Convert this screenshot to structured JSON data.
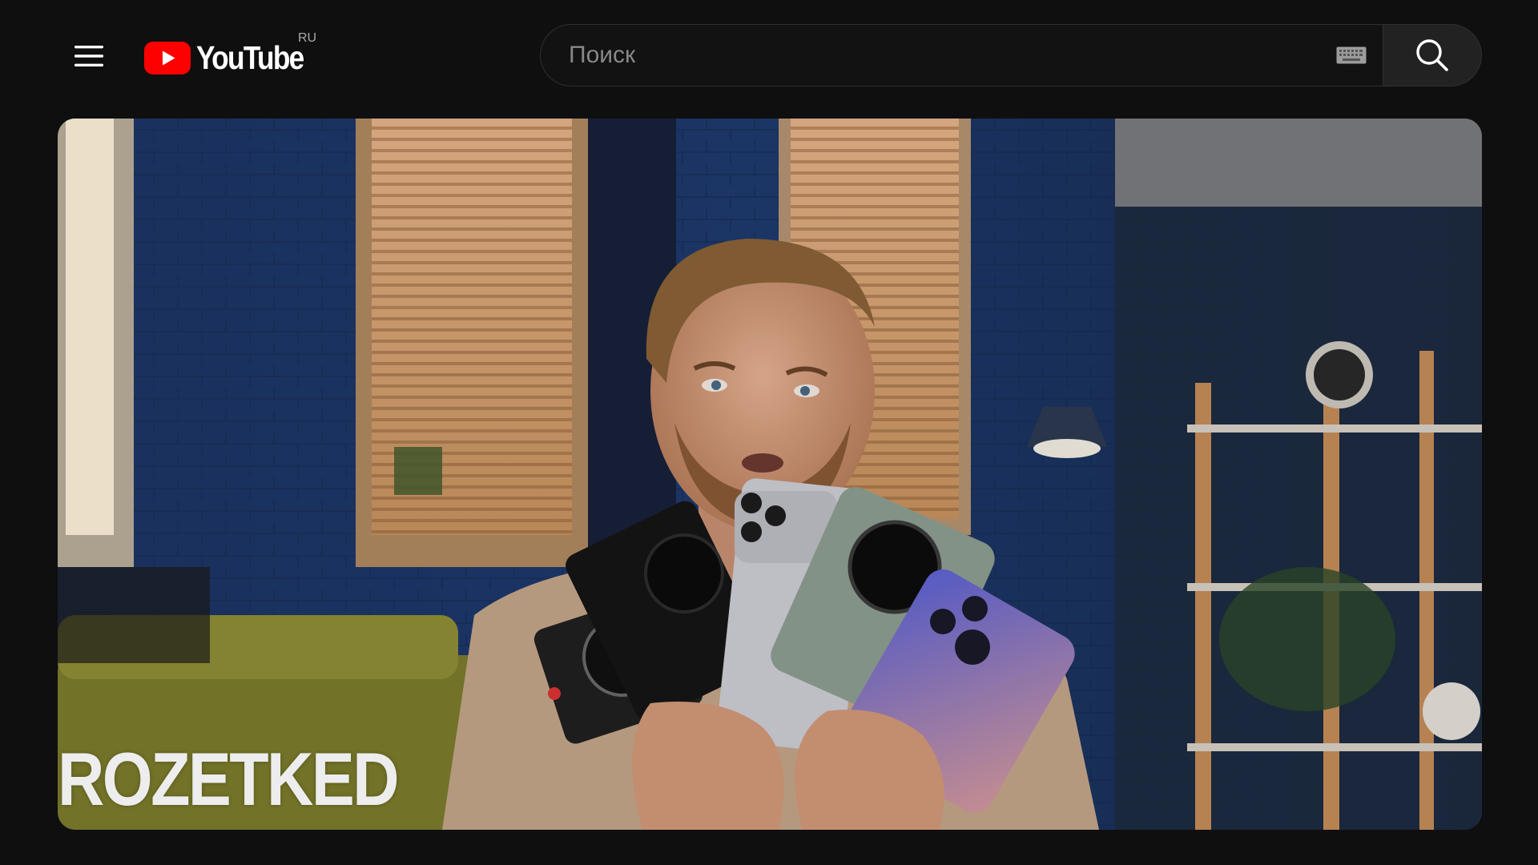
{
  "header": {
    "logo_text": "YouTube",
    "country_code": "RU"
  },
  "search": {
    "placeholder": "Поиск"
  },
  "player": {
    "channel_watermark": "ROZETKED"
  },
  "colors": {
    "background": "#0f0f0f",
    "brand_red": "#ff0000",
    "search_border": "#303030",
    "search_button_bg": "#222222"
  },
  "icons": {
    "menu": "hamburger-menu-icon",
    "logo": "youtube-play-icon",
    "keyboard": "keyboard-icon",
    "search": "search-icon"
  }
}
